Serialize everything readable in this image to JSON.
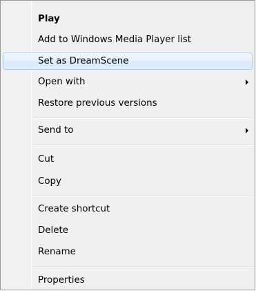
{
  "context_menu": {
    "items": [
      {
        "id": "play",
        "label": "Play"
      },
      {
        "id": "add-to-wmp-list",
        "label": "Add to Windows Media Player list"
      },
      {
        "id": "set-as-dreamscene",
        "label": "Set as DreamScene"
      },
      {
        "id": "open-with",
        "label": "Open with"
      },
      {
        "id": "restore-previous-versions",
        "label": "Restore previous versions"
      },
      {
        "id": "send-to",
        "label": "Send to"
      },
      {
        "id": "cut",
        "label": "Cut"
      },
      {
        "id": "copy",
        "label": "Copy"
      },
      {
        "id": "create-shortcut",
        "label": "Create shortcut"
      },
      {
        "id": "delete",
        "label": "Delete"
      },
      {
        "id": "rename",
        "label": "Rename"
      },
      {
        "id": "properties",
        "label": "Properties"
      }
    ],
    "default_item": "Play",
    "highlighted_item": "Set as DreamScene",
    "submenu_items": [
      "Open with",
      "Send to"
    ],
    "colors": {
      "background": "#f0f0f0",
      "border": "#979797",
      "highlight_border": "#aeccf0",
      "highlight_fill": "#dbe9f9"
    }
  }
}
